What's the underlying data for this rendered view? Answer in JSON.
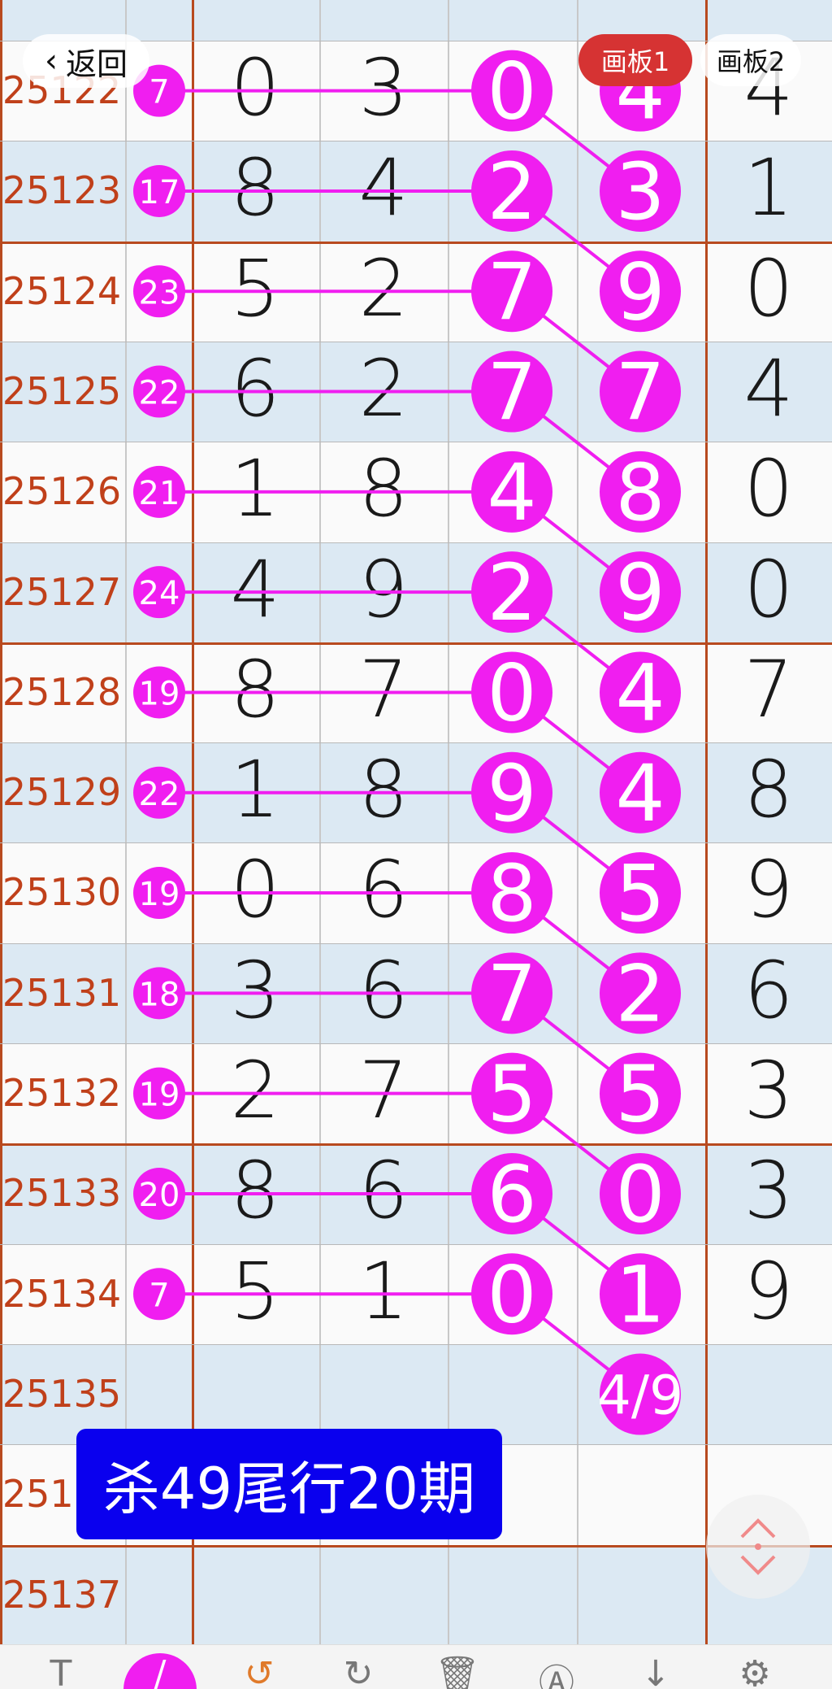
{
  "nav": {
    "back_label": "返回",
    "tab1": "画板1",
    "tab2": "画板2"
  },
  "banner_text": "杀49尾行20期",
  "rows": [
    {
      "period": "25122",
      "sum": "7",
      "d1": "0",
      "d2": "3",
      "d3": "0",
      "d4": "4",
      "d5": "4"
    },
    {
      "period": "25123",
      "sum": "17",
      "d1": "8",
      "d2": "4",
      "d3": "2",
      "d4": "3",
      "d5": "1"
    },
    {
      "period": "25124",
      "sum": "23",
      "d1": "5",
      "d2": "2",
      "d3": "7",
      "d4": "9",
      "d5": "0"
    },
    {
      "period": "25125",
      "sum": "22",
      "d1": "6",
      "d2": "2",
      "d3": "7",
      "d4": "7",
      "d5": "4"
    },
    {
      "period": "25126",
      "sum": "21",
      "d1": "1",
      "d2": "8",
      "d3": "4",
      "d4": "8",
      "d5": "0"
    },
    {
      "period": "25127",
      "sum": "24",
      "d1": "4",
      "d2": "9",
      "d3": "2",
      "d4": "9",
      "d5": "0"
    },
    {
      "period": "25128",
      "sum": "19",
      "d1": "8",
      "d2": "7",
      "d3": "0",
      "d4": "4",
      "d5": "7"
    },
    {
      "period": "25129",
      "sum": "22",
      "d1": "1",
      "d2": "8",
      "d3": "9",
      "d4": "4",
      "d5": "8"
    },
    {
      "period": "25130",
      "sum": "19",
      "d1": "0",
      "d2": "6",
      "d3": "8",
      "d4": "5",
      "d5": "9"
    },
    {
      "period": "25131",
      "sum": "18",
      "d1": "3",
      "d2": "6",
      "d3": "7",
      "d4": "2",
      "d5": "6"
    },
    {
      "period": "25132",
      "sum": "19",
      "d1": "2",
      "d2": "7",
      "d3": "5",
      "d4": "5",
      "d5": "3"
    },
    {
      "period": "25133",
      "sum": "20",
      "d1": "8",
      "d2": "6",
      "d3": "6",
      "d4": "0",
      "d5": "3"
    },
    {
      "period": "25134",
      "sum": "7",
      "d1": "5",
      "d2": "1",
      "d3": "0",
      "d4": "1",
      "d5": "9"
    },
    {
      "period": "25135",
      "sum": "",
      "d1": "",
      "d2": "",
      "d3": "",
      "d4": "4/9",
      "d5": ""
    },
    {
      "period": "25136",
      "sum": "",
      "d1": "",
      "d2": "",
      "d3": "",
      "d4": "",
      "d5": ""
    },
    {
      "period": "25137",
      "sum": "",
      "d1": "",
      "d2": "",
      "d3": "",
      "d4": "",
      "d5": ""
    }
  ],
  "colors": {
    "marker": "#f01ef0",
    "period_text": "#c0401a",
    "banner": "#0a00ee",
    "tab_active": "#d63333"
  },
  "toolbar": [
    "text-tool-icon",
    "pen-tool-icon",
    "undo-icon",
    "redo-icon",
    "trash-icon",
    "autoshape-icon",
    "download-icon",
    "settings-icon"
  ]
}
